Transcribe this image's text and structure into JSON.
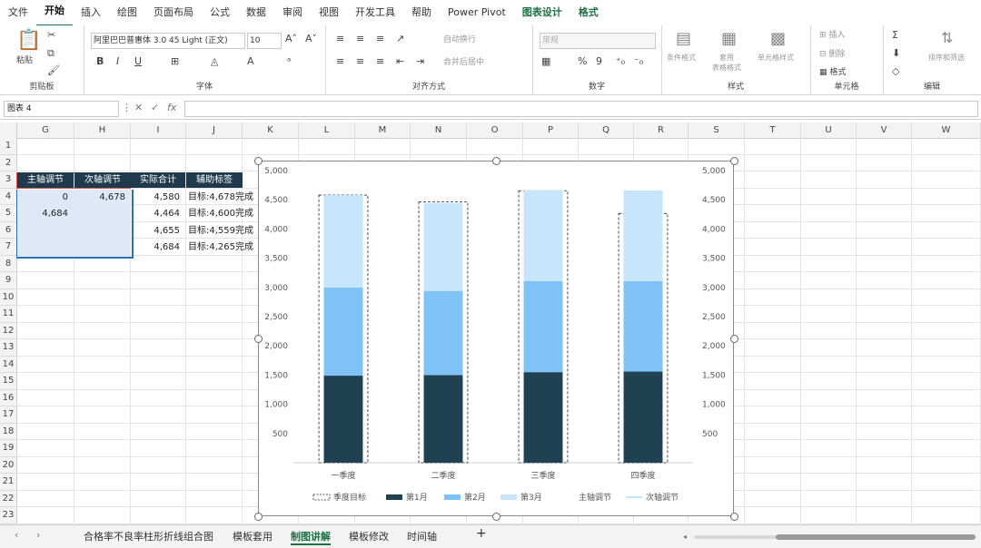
{
  "menu": {
    "tabs": [
      "文件",
      "开始",
      "插入",
      "绘图",
      "页面布局",
      "公式",
      "数据",
      "审阅",
      "视图",
      "开发工具",
      "帮助",
      "Power Pivot",
      "图表设计",
      "格式"
    ],
    "active_index": 1,
    "contextual_indices": [
      12,
      13
    ]
  },
  "ribbon": {
    "clipboard": {
      "paste_label": "粘贴",
      "group_label": "剪贴板"
    },
    "font": {
      "font_name": "阿里巴巴普惠体 3.0 45 Light (正文)",
      "font_size": "10",
      "bold": "B",
      "italic": "I",
      "underline": "U",
      "group_label": "字体"
    },
    "align": {
      "wrap_label": "自动换行",
      "merge_label": "合并后居中",
      "group_label": "对齐方式"
    },
    "number": {
      "format_value": "常规",
      "group_label": "数字"
    },
    "styles": {
      "cond_label": "条件格式",
      "table_label": "套用\n表格格式",
      "cell_label": "单元格样式",
      "group_label": "样式"
    },
    "cells": {
      "insert_label": "插入",
      "delete_label": "删除",
      "format_label": "格式",
      "group_label": "单元格"
    },
    "edit": {
      "sort_label": "排序和筛选",
      "group_label": "编辑"
    }
  },
  "formula_bar": {
    "name_box": "图表 4",
    "fx": "fx",
    "formula": ""
  },
  "columns": [
    "G",
    "H",
    "I",
    "J",
    "K",
    "L",
    "M",
    "N",
    "O",
    "P",
    "Q",
    "R",
    "S",
    "T",
    "U",
    "V",
    "W"
  ],
  "rows": [
    "1",
    "2",
    "3",
    "4",
    "5",
    "6",
    "7",
    "8",
    "9",
    "10",
    "11",
    "12",
    "13",
    "14",
    "15",
    "16",
    "17",
    "18",
    "19",
    "20",
    "21",
    "22",
    "23"
  ],
  "table": {
    "headers": [
      "主轴调节",
      "次轴调节",
      "实际合计",
      "辅助标签"
    ],
    "rows": [
      [
        "0",
        "4,678",
        "4,580",
        "目标:4,678完成"
      ],
      [
        "4,684",
        "",
        "4,464",
        "目标:4,600完成"
      ],
      [
        "",
        "",
        "4,655",
        "目标:4,559完成"
      ],
      [
        "",
        "",
        "4,684",
        "目标:4,265完成"
      ]
    ]
  },
  "colors": {
    "header": "#1f3a4d",
    "m1": "#1f4152",
    "m2": "#7fc2f5",
    "m3": "#c7e6fb",
    "accent": "#1e7145"
  },
  "chart_data": {
    "type": "bar",
    "stacked": true,
    "categories": [
      "一季度",
      "二季度",
      "三季度",
      "四季度"
    ],
    "series": [
      {
        "name": "第1月",
        "values": [
          1490,
          1500,
          1550,
          1560
        ]
      },
      {
        "name": "第2月",
        "values": [
          1510,
          1440,
          1560,
          1550
        ]
      },
      {
        "name": "第3月",
        "values": [
          1580,
          1500,
          1550,
          1550
        ]
      }
    ],
    "target": {
      "name": "季度目标",
      "values": [
        4580,
        4464,
        4655,
        4265
      ]
    },
    "legend": [
      "季度目标",
      "第1月",
      "第2月",
      "第3月",
      "主轴调节",
      "次轴调节"
    ],
    "ylim": [
      0,
      5000
    ],
    "ticks": [
      "500",
      "1,000",
      "1,500",
      "2,000",
      "2,500",
      "3,000",
      "3,500",
      "4,000",
      "4,500",
      "5,000"
    ],
    "legend_position": "bottom",
    "grid": false
  },
  "sheets": {
    "tabs": [
      "合格率不良率柱形折线组合图",
      "模板套用",
      "制图讲解",
      "模板修改",
      "时间轴"
    ],
    "active_index": 2,
    "add": "+"
  }
}
